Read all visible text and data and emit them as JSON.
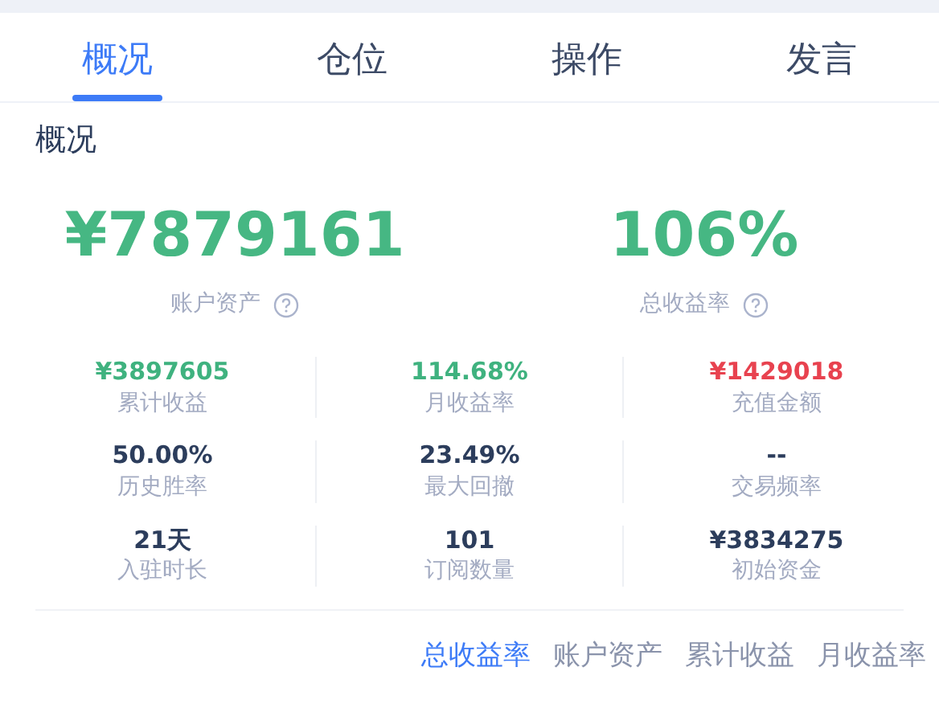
{
  "tabs": [
    {
      "label": "概况",
      "selected": true
    },
    {
      "label": "仓位",
      "selected": false
    },
    {
      "label": "操作",
      "selected": false
    },
    {
      "label": "发言",
      "selected": false
    }
  ],
  "section_title": "概况",
  "headline": [
    {
      "value": "¥7879161",
      "label": "账户资产"
    },
    {
      "value": "106%",
      "label": "总收益率"
    }
  ],
  "stats": [
    {
      "value": "¥3897605",
      "label": "累计收益",
      "color": "#3fb27f"
    },
    {
      "value": "114.68%",
      "label": "月收益率",
      "color": "#3fb27f"
    },
    {
      "value": "¥1429018",
      "label": "充值金额",
      "color": "#e8424f"
    },
    {
      "value": "50.00%",
      "label": "历史胜率",
      "color": "#2c3d5c"
    },
    {
      "value": "23.49%",
      "label": "最大回撤",
      "color": "#2c3d5c"
    },
    {
      "value": "--",
      "label": "交易频率",
      "color": "#2c3d5c"
    },
    {
      "value": "21天",
      "label": "入驻时长",
      "color": "#2c3d5c"
    },
    {
      "value": "101",
      "label": "订阅数量",
      "color": "#2c3d5c"
    },
    {
      "value": "¥3834275",
      "label": "初始资金",
      "color": "#2c3d5c"
    }
  ],
  "chart_tabs": [
    {
      "label": "总收益率",
      "selected": true
    },
    {
      "label": "账户资产",
      "selected": false
    },
    {
      "label": "累计收益",
      "selected": false
    },
    {
      "label": "月收益率",
      "selected": false
    }
  ]
}
